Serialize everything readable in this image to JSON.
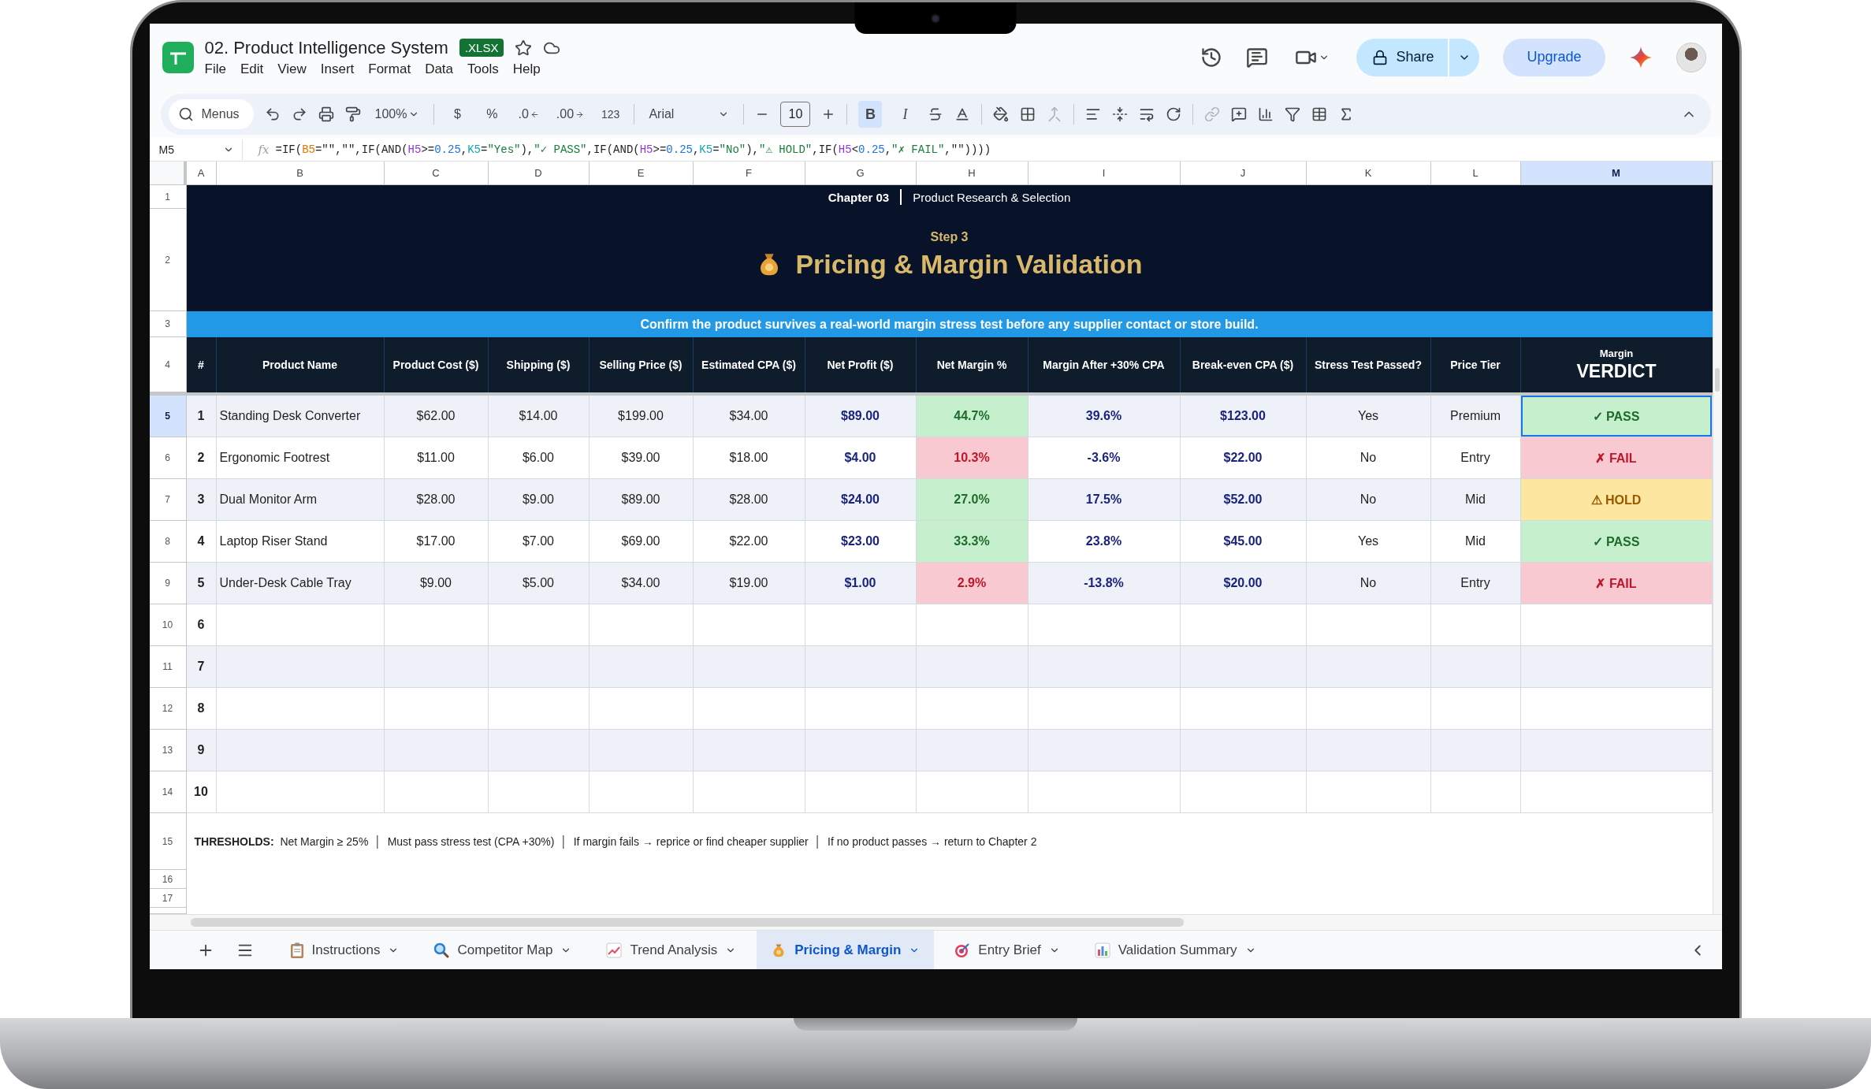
{
  "document": {
    "title": "02. Product Intelligence System",
    "badge": ".XLSX"
  },
  "menu": [
    "File",
    "Edit",
    "View",
    "Insert",
    "Format",
    "Data",
    "Tools",
    "Help"
  ],
  "header_actions": {
    "share": "Share",
    "upgrade": "Upgrade"
  },
  "toolbar": {
    "search": "Menus",
    "zoom": "100%",
    "currency": "$",
    "percent": "%",
    "decrease_decimal": ".0",
    "increase_decimal": ".00",
    "number_format": "123",
    "font": "Arial",
    "font_size": "10",
    "bold": {
      "label": "B",
      "selected": true
    },
    "italic": {
      "label": "I",
      "selected": false
    }
  },
  "name_box": "M5",
  "formula_icon": "fx",
  "formula": [
    {
      "text": "=IF(",
      "kind": "plain"
    },
    {
      "text": "B5",
      "kind": "ref",
      "color": "#e37400"
    },
    {
      "text": "=\"\",\"\",IF(AND(",
      "kind": "plain"
    },
    {
      "text": "H5",
      "kind": "ref",
      "color": "#9334e6"
    },
    {
      "text": ">=",
      "kind": "plain"
    },
    {
      "text": "0.25",
      "kind": "num"
    },
    {
      "text": ",",
      "kind": "plain"
    },
    {
      "text": "K5",
      "kind": "ref",
      "color": "#12a5b8"
    },
    {
      "text": "=",
      "kind": "plain"
    },
    {
      "text": "\"Yes\"",
      "kind": "str"
    },
    {
      "text": "),",
      "kind": "plain"
    },
    {
      "text": "\"✓ PASS\"",
      "kind": "str"
    },
    {
      "text": ",IF(AND(",
      "kind": "plain"
    },
    {
      "text": "H5",
      "kind": "ref",
      "color": "#9334e6"
    },
    {
      "text": ">=",
      "kind": "plain"
    },
    {
      "text": "0.25",
      "kind": "num"
    },
    {
      "text": ",",
      "kind": "plain"
    },
    {
      "text": "K5",
      "kind": "ref",
      "color": "#12a5b8"
    },
    {
      "text": "=",
      "kind": "plain"
    },
    {
      "text": "\"No\"",
      "kind": "str"
    },
    {
      "text": "),",
      "kind": "plain"
    },
    {
      "text": "\"⚠ HOLD\"",
      "kind": "str"
    },
    {
      "text": ",IF(",
      "kind": "plain"
    },
    {
      "text": "H5",
      "kind": "ref",
      "color": "#9334e6"
    },
    {
      "text": "<",
      "kind": "plain"
    },
    {
      "text": "0.25",
      "kind": "num"
    },
    {
      "text": ",",
      "kind": "plain"
    },
    {
      "text": "\"✗ FAIL\"",
      "kind": "str"
    },
    {
      "text": ",\"\"))))",
      "kind": "plain"
    }
  ],
  "columns": [
    {
      "label": "A",
      "selected": false
    },
    {
      "label": "B",
      "selected": false
    },
    {
      "label": "C",
      "selected": false
    },
    {
      "label": "D",
      "selected": false
    },
    {
      "label": "E",
      "selected": false
    },
    {
      "label": "F",
      "selected": false
    },
    {
      "label": "G",
      "selected": false
    },
    {
      "label": "H",
      "selected": false
    },
    {
      "label": "I",
      "selected": false
    },
    {
      "label": "J",
      "selected": false
    },
    {
      "label": "K",
      "selected": false
    },
    {
      "label": "L",
      "selected": false
    },
    {
      "label": "M",
      "selected": true
    }
  ],
  "row_numbers": [
    {
      "label": "1",
      "selected": false
    },
    {
      "label": "2",
      "selected": false
    },
    {
      "label": "3",
      "selected": false
    },
    {
      "label": "4",
      "selected": false
    },
    {
      "label": "5",
      "selected": true
    },
    {
      "label": "6",
      "selected": false
    },
    {
      "label": "7",
      "selected": false
    },
    {
      "label": "8",
      "selected": false
    },
    {
      "label": "9",
      "selected": false
    },
    {
      "label": "10",
      "selected": false
    },
    {
      "label": "11",
      "selected": false
    },
    {
      "label": "12",
      "selected": false
    },
    {
      "label": "13",
      "selected": false
    },
    {
      "label": "14",
      "selected": false
    },
    {
      "label": "15",
      "selected": false
    },
    {
      "label": "16",
      "selected": false
    },
    {
      "label": "17",
      "selected": false
    }
  ],
  "sheet": {
    "chapter": "Chapter 03",
    "section": "Product Research & Selection",
    "step": "Step 3",
    "title": "Pricing & Margin Validation",
    "banner": "Confirm the product survives a real-world margin stress test before any supplier contact or store build.",
    "headers": [
      "#",
      "Product Name",
      "Product Cost ($)",
      "Shipping ($)",
      "Selling Price ($)",
      "Estimated CPA ($)",
      "Net Profit ($)",
      "Net Margin %",
      "Margin After +30% CPA",
      "Break-even CPA ($)",
      "Stress Test Passed?",
      "Price Tier"
    ],
    "verdict_header": {
      "small": "Margin",
      "large": "VERDICT"
    },
    "rows": [
      {
        "num": "1",
        "name": "Standing Desk Converter",
        "cost": "$62.00",
        "shipping": "$14.00",
        "price": "$199.00",
        "cpa": "$34.00",
        "profit": "$89.00",
        "margin": {
          "text": "44.7%",
          "kind": "good"
        },
        "after_cpa": "39.6%",
        "breakeven": "$123.00",
        "stress": "Yes",
        "tier": "Premium",
        "verdict": {
          "text": "✓ PASS",
          "kind": "pass"
        },
        "selected": true
      },
      {
        "num": "2",
        "name": "Ergonomic Footrest",
        "cost": "$11.00",
        "shipping": "$6.00",
        "price": "$39.00",
        "cpa": "$18.00",
        "profit": "$4.00",
        "margin": {
          "text": "10.3%",
          "kind": "bad"
        },
        "after_cpa": "-3.6%",
        "breakeven": "$22.00",
        "stress": "No",
        "tier": "Entry",
        "verdict": {
          "text": "✗ FAIL",
          "kind": "fail"
        },
        "selected": false
      },
      {
        "num": "3",
        "name": "Dual Monitor Arm",
        "cost": "$28.00",
        "shipping": "$9.00",
        "price": "$89.00",
        "cpa": "$28.00",
        "profit": "$24.00",
        "margin": {
          "text": "27.0%",
          "kind": "good"
        },
        "after_cpa": "17.5%",
        "breakeven": "$52.00",
        "stress": "No",
        "tier": "Mid",
        "verdict": {
          "text": "⚠ HOLD",
          "kind": "hold"
        },
        "selected": false
      },
      {
        "num": "4",
        "name": "Laptop Riser Stand",
        "cost": "$17.00",
        "shipping": "$7.00",
        "price": "$69.00",
        "cpa": "$22.00",
        "profit": "$23.00",
        "margin": {
          "text": "33.3%",
          "kind": "good"
        },
        "after_cpa": "23.8%",
        "breakeven": "$45.00",
        "stress": "Yes",
        "tier": "Mid",
        "verdict": {
          "text": "✓ PASS",
          "kind": "pass"
        },
        "selected": false
      },
      {
        "num": "5",
        "name": "Under-Desk Cable Tray",
        "cost": "$9.00",
        "shipping": "$5.00",
        "price": "$34.00",
        "cpa": "$19.00",
        "profit": "$1.00",
        "margin": {
          "text": "2.9%",
          "kind": "bad"
        },
        "after_cpa": "-13.8%",
        "breakeven": "$20.00",
        "stress": "No",
        "tier": "Entry",
        "verdict": {
          "text": "✗ FAIL",
          "kind": "fail"
        },
        "selected": false
      }
    ],
    "empty_rows": [
      "6",
      "7",
      "8",
      "9",
      "10"
    ],
    "thresholds": "**THRESHOLDS:**  Net Margin ≥ 25%  │  Must pass stress test (CPA +30%)  │  If margin fails → reprice or find cheaper supplier  │  If no product passes → return to Chapter 2"
  },
  "tabs": [
    {
      "label": "Instructions",
      "kind": "clipboard",
      "selected": false
    },
    {
      "label": "Competitor Map",
      "kind": "magnifier",
      "selected": false
    },
    {
      "label": "Trend Analysis",
      "kind": "trend",
      "selected": false
    },
    {
      "label": "Pricing & Margin",
      "kind": "moneybag",
      "selected": true
    },
    {
      "label": "Entry Brief",
      "kind": "target",
      "selected": false
    },
    {
      "label": "Validation Summary",
      "kind": "bars",
      "selected": false
    }
  ]
}
